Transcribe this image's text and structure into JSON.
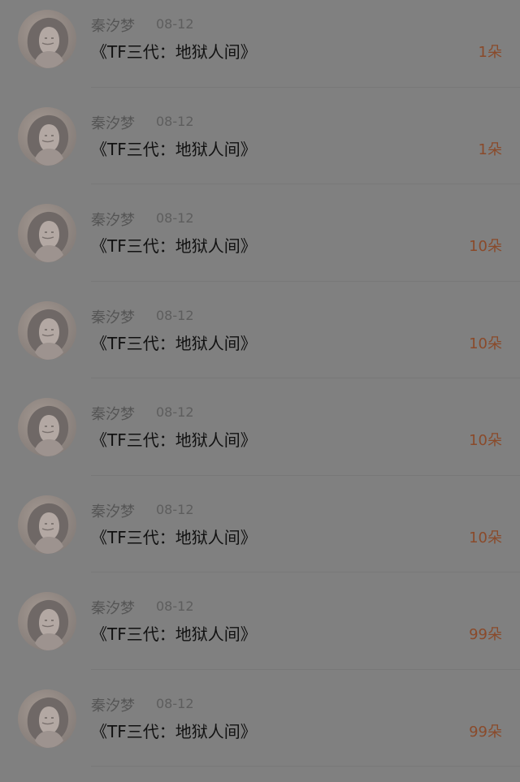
{
  "gift_list": {
    "items": [
      {
        "user": "秦汐梦",
        "date": "08-12",
        "title": "《TF三代：地狱人间》",
        "amount": "1朵"
      },
      {
        "user": "秦汐梦",
        "date": "08-12",
        "title": "《TF三代：地狱人间》",
        "amount": "1朵"
      },
      {
        "user": "秦汐梦",
        "date": "08-12",
        "title": "《TF三代：地狱人间》",
        "amount": "10朵"
      },
      {
        "user": "秦汐梦",
        "date": "08-12",
        "title": "《TF三代：地狱人间》",
        "amount": "10朵"
      },
      {
        "user": "秦汐梦",
        "date": "08-12",
        "title": "《TF三代：地狱人间》",
        "amount": "10朵"
      },
      {
        "user": "秦汐梦",
        "date": "08-12",
        "title": "《TF三代：地狱人间》",
        "amount": "10朵"
      },
      {
        "user": "秦汐梦",
        "date": "08-12",
        "title": "《TF三代：地狱人间》",
        "amount": "99朵"
      },
      {
        "user": "秦汐梦",
        "date": "08-12",
        "title": "《TF三代：地狱人间》",
        "amount": "99朵"
      }
    ]
  },
  "colors": {
    "overlay_background": "#808080",
    "amount_text": "#8a4a2a",
    "name_text": "#555555",
    "title_text": "#111111"
  }
}
